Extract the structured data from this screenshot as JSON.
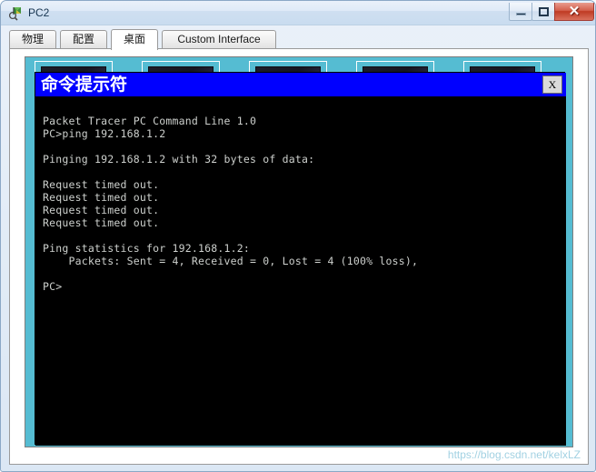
{
  "window": {
    "title": "PC2",
    "icon": "packet-tracer-pc-icon",
    "buttons": {
      "minimize": "–",
      "maximize": "□",
      "close": "✕"
    }
  },
  "tabs": [
    {
      "label": "物理",
      "active": false
    },
    {
      "label": "配置",
      "active": false
    },
    {
      "label": "桌面",
      "active": true
    },
    {
      "label": "Custom Interface",
      "active": false
    }
  ],
  "desktop": {
    "background_color": "#55bcd2",
    "icon_count": 5
  },
  "cmd": {
    "title": "命令提示符",
    "close_label": "X",
    "titlebar_color": "#0000ff",
    "background_color": "#000000",
    "text_color": "#cdd0cd",
    "lines": [
      "Packet Tracer PC Command Line 1.0",
      "PC>ping 192.168.1.2",
      "",
      "Pinging 192.168.1.2 with 32 bytes of data:",
      "",
      "Request timed out.",
      "Request timed out.",
      "Request timed out.",
      "Request timed out.",
      "",
      "Ping statistics for 192.168.1.2:",
      "    Packets: Sent = 4, Received = 0, Lost = 4 (100% loss),",
      "",
      "PC>"
    ]
  },
  "watermark": {
    "text": "https://blog.csdn.net/kelxLZ"
  }
}
